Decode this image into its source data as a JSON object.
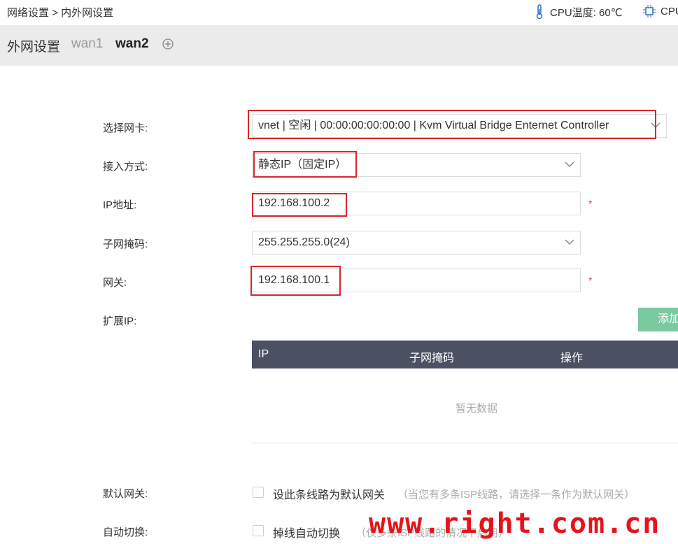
{
  "breadcrumb": {
    "parent": "网络设置",
    "separator": ">",
    "current": "内外网设置"
  },
  "status": {
    "cpu_temp": "CPU温度: 60℃",
    "cpu": "CPU"
  },
  "tabs": {
    "title": "外网设置",
    "items": [
      {
        "label": "wan1"
      },
      {
        "label": "wan2"
      }
    ],
    "active": "wan2"
  },
  "form": {
    "nic": {
      "label": "选择网卡:",
      "value": "vnet | 空闲 | 00:00:00:00:00:00 | Kvm Virtual Bridge Enternet Controller"
    },
    "access": {
      "label": "接入方式:",
      "value": "静态IP（固定IP）"
    },
    "ip": {
      "label": "IP地址:",
      "value": "192.168.100.2",
      "required": "*"
    },
    "mask": {
      "label": "子网掩码:",
      "value": "255.255.255.0(24)"
    },
    "gateway": {
      "label": "网关:",
      "value": "192.168.100.1",
      "required": "*"
    },
    "ext_ip": {
      "label": "扩展IP:",
      "add_button": "添加"
    }
  },
  "table": {
    "columns": [
      "IP",
      "子网掩码",
      "操作"
    ],
    "empty_text": "暂无数据"
  },
  "default_gw": {
    "label": "默认网关:",
    "checkbox_text": "设此条线路为默认网关",
    "hint": "（当您有多条ISP线路，请选择一条作为默认网关）"
  },
  "auto_switch": {
    "label": "自动切换:",
    "checkbox_text": "掉线自动切换",
    "hint": "（仅多条ISP线路的情况下启用）"
  },
  "watermark": "www.right.com.cn",
  "colors": {
    "highlight": "#d9262a",
    "table_header": "#4c5063",
    "add_button": "#79c9a1",
    "required": "#e64340"
  }
}
